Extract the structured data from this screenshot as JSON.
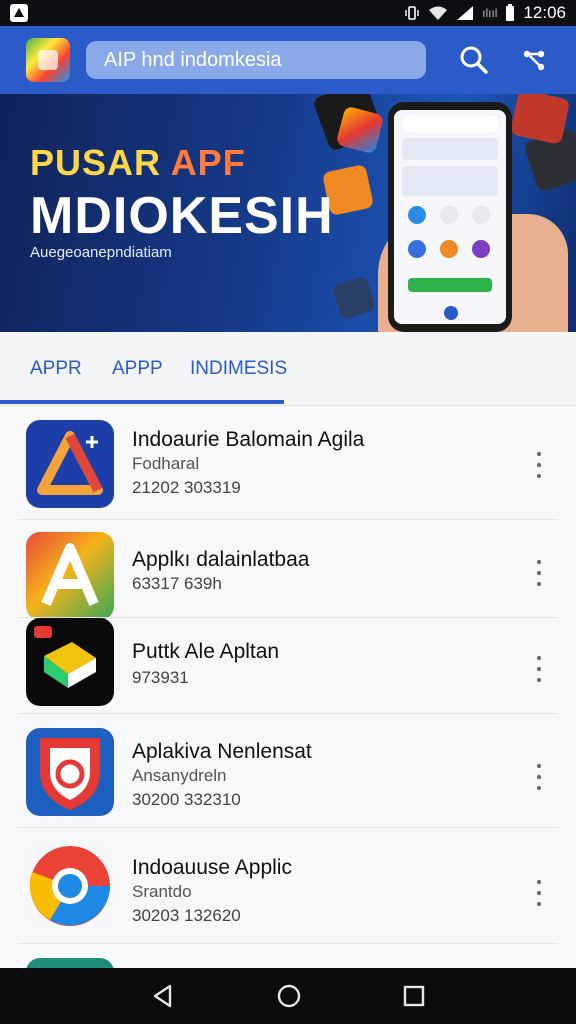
{
  "status_bar": {
    "carrier": "ılııl",
    "time": "12:06"
  },
  "header": {
    "search_placeholder": "AIP hnd indomkesia"
  },
  "banner": {
    "title_part1": "PUSAR ",
    "title_part2": "APF",
    "title_line2": "MDIOKESIH",
    "subtitle": "Auegeoanepndiatiam"
  },
  "tabs": [
    {
      "label": "APPR"
    },
    {
      "label": "APPP"
    },
    {
      "label": "INDIMESIS"
    }
  ],
  "apps": [
    {
      "name": "Indoaurie Balomain Agila",
      "developer": "Fodharal",
      "meta": "21202 303319",
      "icon": "delta-icon",
      "colors": [
        "#1d3ea8",
        "#f2a33a",
        "#e0473b"
      ]
    },
    {
      "name": "Applkı dalainlatbaa",
      "developer": "",
      "meta": "63317 639h",
      "icon": "letter-a-icon",
      "colors": [
        "#e84a3a",
        "#f6b21a",
        "#34a853"
      ]
    },
    {
      "name": "Puttk Ale Apltan",
      "developer": "",
      "meta": "973931",
      "icon": "cube-icon",
      "colors": [
        "#0a0a0a",
        "#f1c40f",
        "#2ecc71"
      ]
    },
    {
      "name": "Aplakiva Nenlensat",
      "developer": "Ansanydreln",
      "meta": "30200 332310",
      "icon": "shield-icon",
      "colors": [
        "#e53935",
        "#1e5fbf",
        "#ffffff"
      ]
    },
    {
      "name": "Indoauuse Applic",
      "developer": "Srantdo",
      "meta": "30203 132620",
      "icon": "chrome-like-icon",
      "colors": [
        "#ea4335",
        "#fbbc05",
        "#1e88e5"
      ]
    }
  ]
}
